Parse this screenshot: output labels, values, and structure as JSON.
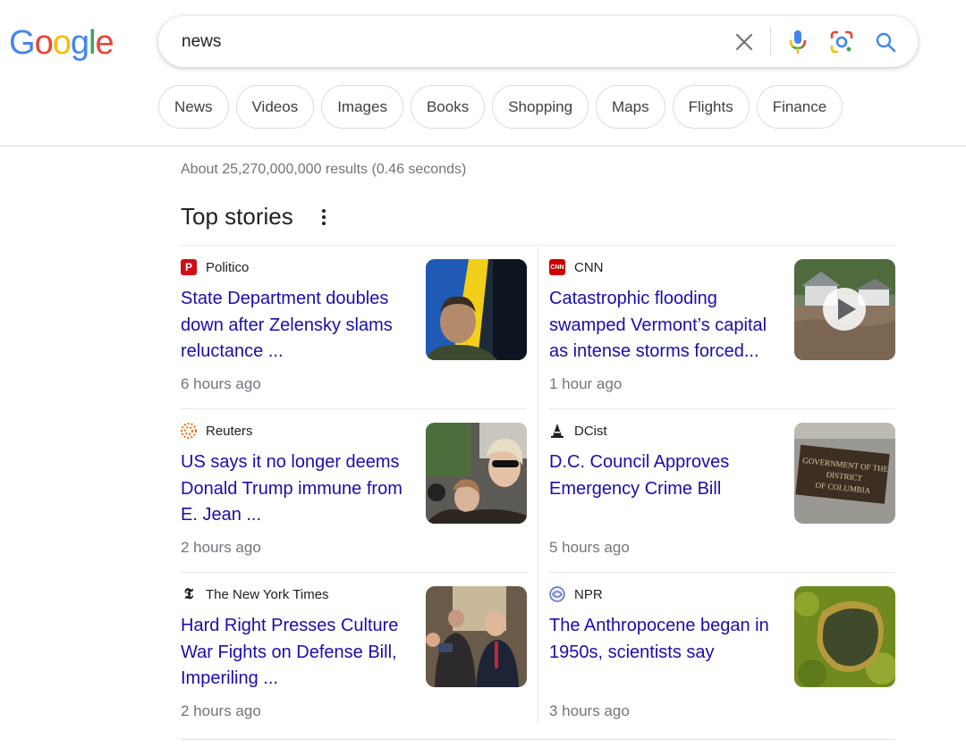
{
  "logo": {
    "letters": [
      "G",
      "o",
      "o",
      "g",
      "l",
      "e"
    ],
    "colors": [
      "#4285F4",
      "#EA4335",
      "#FBBC05",
      "#4285F4",
      "#34A853",
      "#EA4335"
    ]
  },
  "search": {
    "query": "news",
    "placeholder": ""
  },
  "chips": [
    "News",
    "Videos",
    "Images",
    "Books",
    "Shopping",
    "Maps",
    "Flights",
    "Finance"
  ],
  "results": {
    "stats": "About 25,270,000,000 results (0.46 seconds)"
  },
  "top_stories": {
    "title": "Top stories",
    "cards": [
      {
        "source": "Politico",
        "icon": "politico-icon",
        "headline": "State Department doubles down after Zelensky slams reluctance ...",
        "time": "6 hours ago",
        "thumb": "zelensky-photo"
      },
      {
        "source": "CNN",
        "icon": "cnn-icon",
        "headline": "Catastrophic flooding swamped Vermont’s capital as intense storms forced...",
        "time": "1 hour ago",
        "thumb": "flooding-video-thumb"
      },
      {
        "source": "Reuters",
        "icon": "reuters-icon",
        "headline": "US says it no longer deems Donald Trump immune from E. Jean ...",
        "time": "2 hours ago",
        "thumb": "crowd-photo"
      },
      {
        "source": "DCist",
        "icon": "dcist-icon",
        "headline": "D.C. Council Approves Emergency Crime Bill",
        "time": "5 hours ago",
        "thumb": "dc-sign-photo",
        "sign_text": [
          "GOVERNMENT OF THE",
          "DISTRICT",
          "OF COLUMBIA"
        ]
      },
      {
        "source": "The New York Times",
        "icon": "nyt-icon",
        "headline": "Hard Right Presses Culture War Fights on Defense Bill, Imperiling ...",
        "time": "2 hours ago",
        "thumb": "capitol-press-photo"
      },
      {
        "source": "NPR",
        "icon": "npr-icon",
        "headline": "The Anthropocene began in 1950s, scientists say",
        "time": "3 hours ago",
        "thumb": "lake-aerial-photo"
      }
    ]
  }
}
